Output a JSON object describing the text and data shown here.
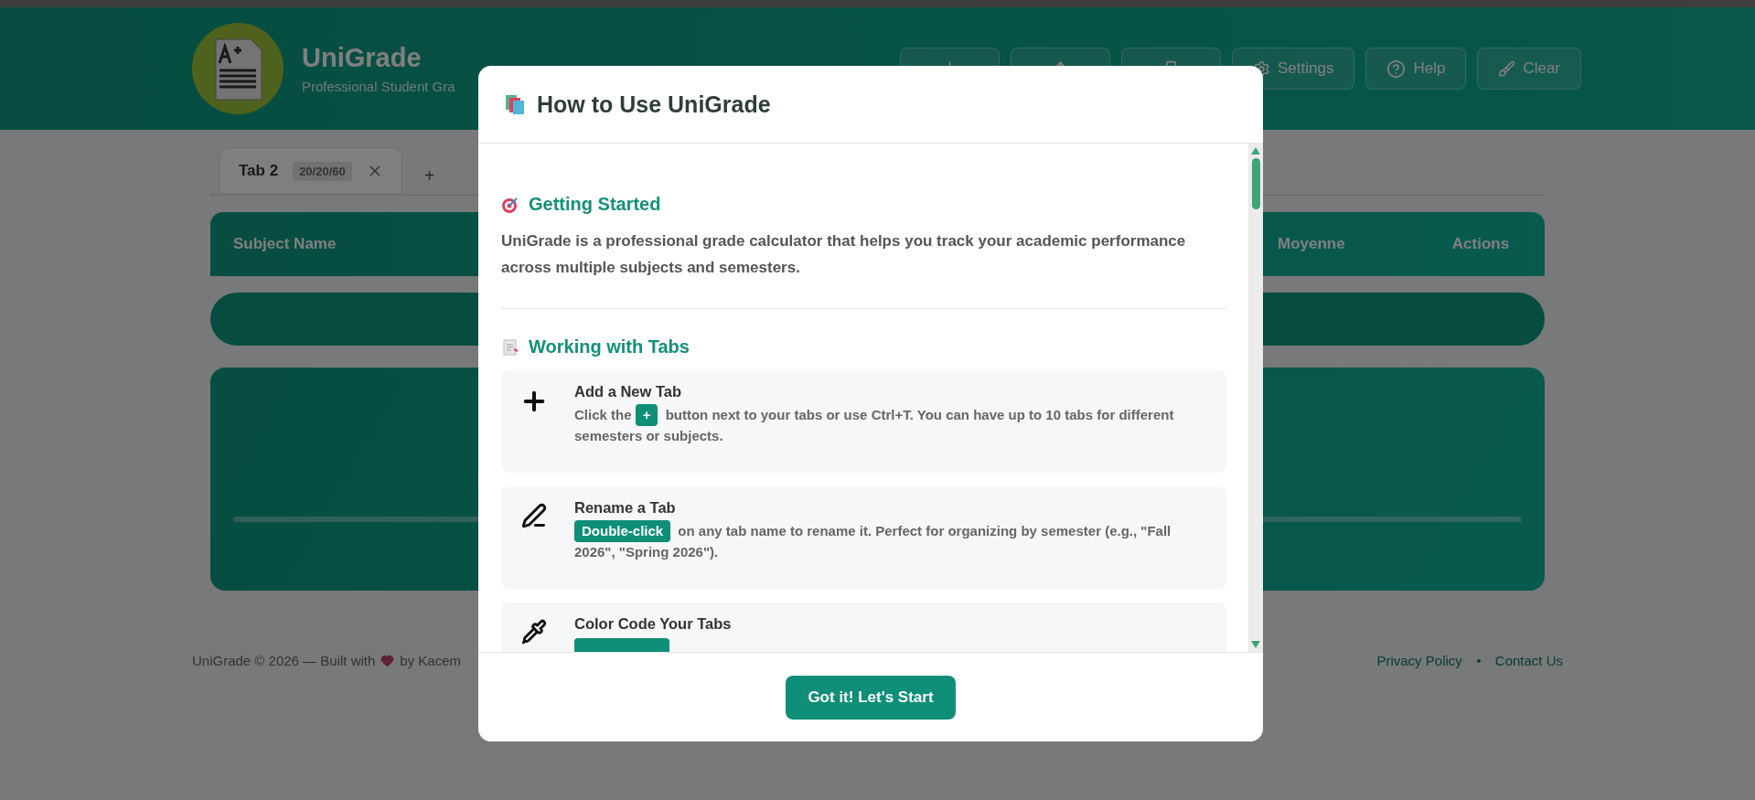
{
  "header": {
    "title": "UniGrade",
    "subtitle": "Professional Student Gra",
    "actions": [
      {
        "kind": "import"
      },
      {
        "kind": "export"
      },
      {
        "kind": "print"
      },
      {
        "kind": "settings",
        "label": "Settings"
      },
      {
        "kind": "help",
        "label": "Help"
      },
      {
        "kind": "clear",
        "label": "Clear"
      }
    ]
  },
  "tabs": [
    {
      "label": "Tab 2",
      "weights": "20/20/60",
      "selected": true
    }
  ],
  "add_tab": "+",
  "table": {
    "columns": [
      "Subject Name",
      "Moyenne",
      "Actions"
    ]
  },
  "footer": {
    "text": "UniGrade © 2026 — Built with",
    "author": "by Kacem",
    "links": [
      "Privacy Policy",
      "Contact Us"
    ]
  },
  "modal": {
    "title": "How to Use UniGrade",
    "sections": [
      {
        "kind": "paragraph",
        "heading": "Getting Started",
        "text": "UniGrade is a professional grade calculator that helps you track your academic performance across multiple subjects and semesters."
      },
      {
        "kind": "cards",
        "heading": "Working with Tabs",
        "cards": [
          {
            "title": "Add a New Tab",
            "before": "Click the",
            "badge": "+",
            "after": "button next to your tabs or use Ctrl+T. You can have up to 10 tabs for different semesters or subjects."
          },
          {
            "title": "Rename a Tab",
            "badge": "Double-click",
            "after": "on any tab name to rename it. Perfect for organizing by semester (e.g., \"Fall 2026\", \"Spring 2026\")."
          },
          {
            "title": "Color Code Your Tabs"
          }
        ]
      }
    ],
    "button": "Got it! Let's Start"
  }
}
